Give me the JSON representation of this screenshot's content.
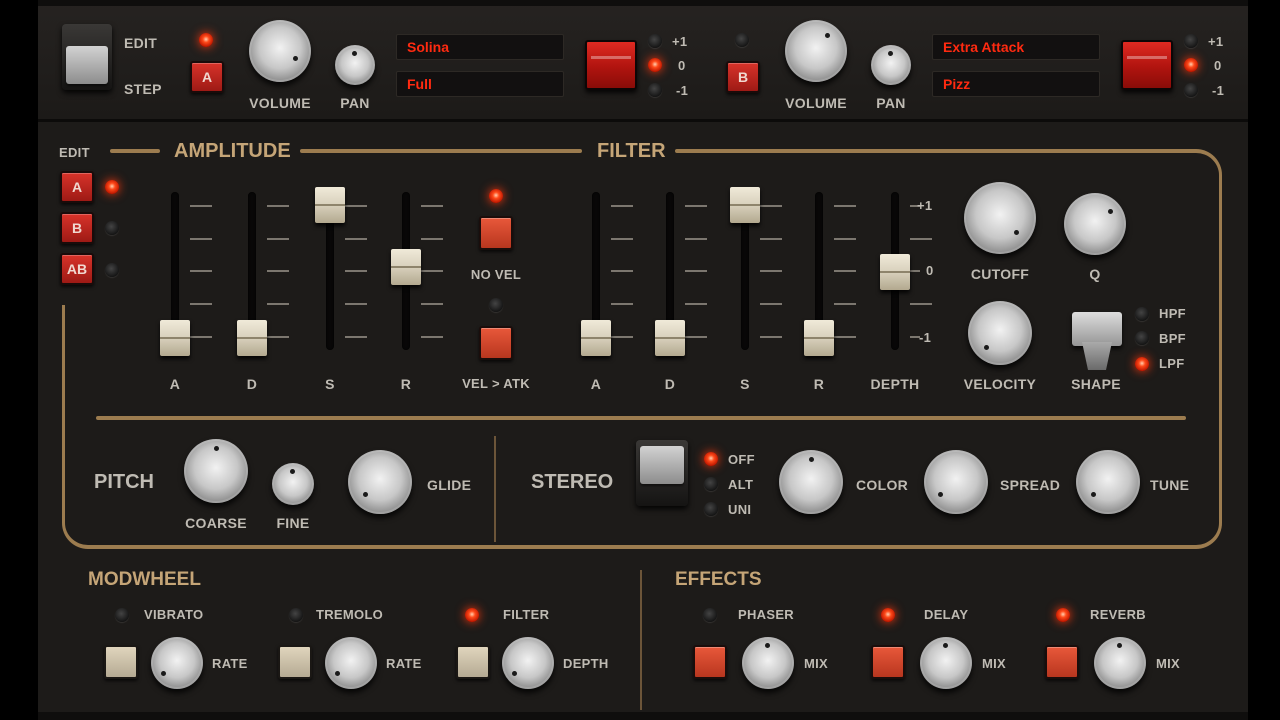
{
  "top": {
    "edit_label": "EDIT",
    "step_label": "STEP",
    "layer_a": {
      "button": "A",
      "volume_label": "VOLUME",
      "pan_label": "PAN",
      "display1": "Solina",
      "display2": "Full",
      "oct_plus": "+1",
      "oct_zero": "0",
      "oct_minus": "-1"
    },
    "layer_b": {
      "button": "B",
      "volume_label": "VOLUME",
      "pan_label": "PAN",
      "display1": "Extra Attack",
      "display2": "Pizz",
      "oct_plus": "+1",
      "oct_zero": "0",
      "oct_minus": "-1"
    }
  },
  "edit": {
    "label": "EDIT",
    "buttons": [
      "A",
      "B",
      "AB"
    ]
  },
  "amplitude": {
    "title": "AMPLITUDE",
    "faders": [
      "A",
      "D",
      "S",
      "R"
    ],
    "no_vel": "NO VEL",
    "vel_atk": "VEL > ATK"
  },
  "filter": {
    "title": "FILTER",
    "faders": [
      "A",
      "D",
      "S",
      "R",
      "DEPTH"
    ],
    "depth_scale": [
      "+1",
      "0",
      "-1"
    ],
    "cutoff": "CUTOFF",
    "q": "Q",
    "velocity": "VELOCITY",
    "shape": "SHAPE",
    "shape_opts": [
      "HPF",
      "BPF",
      "LPF"
    ]
  },
  "pitch": {
    "title": "PITCH",
    "coarse": "COARSE",
    "fine": "FINE",
    "glide": "GLIDE"
  },
  "stereo": {
    "title": "STEREO",
    "opts": [
      "OFF",
      "ALT",
      "UNI"
    ],
    "color": "COLOR",
    "spread": "SPREAD",
    "tune": "TUNE"
  },
  "modwheel": {
    "title": "MODWHEEL",
    "vibrato": "VIBRATO",
    "tremolo": "TREMOLO",
    "filter": "FILTER",
    "rate1": "RATE",
    "rate2": "RATE",
    "depth": "DEPTH"
  },
  "effects": {
    "title": "EFFECTS",
    "phaser": "PHASER",
    "delay": "DELAY",
    "reverb": "REVERB",
    "mix1": "MIX",
    "mix2": "MIX",
    "mix3": "MIX"
  }
}
